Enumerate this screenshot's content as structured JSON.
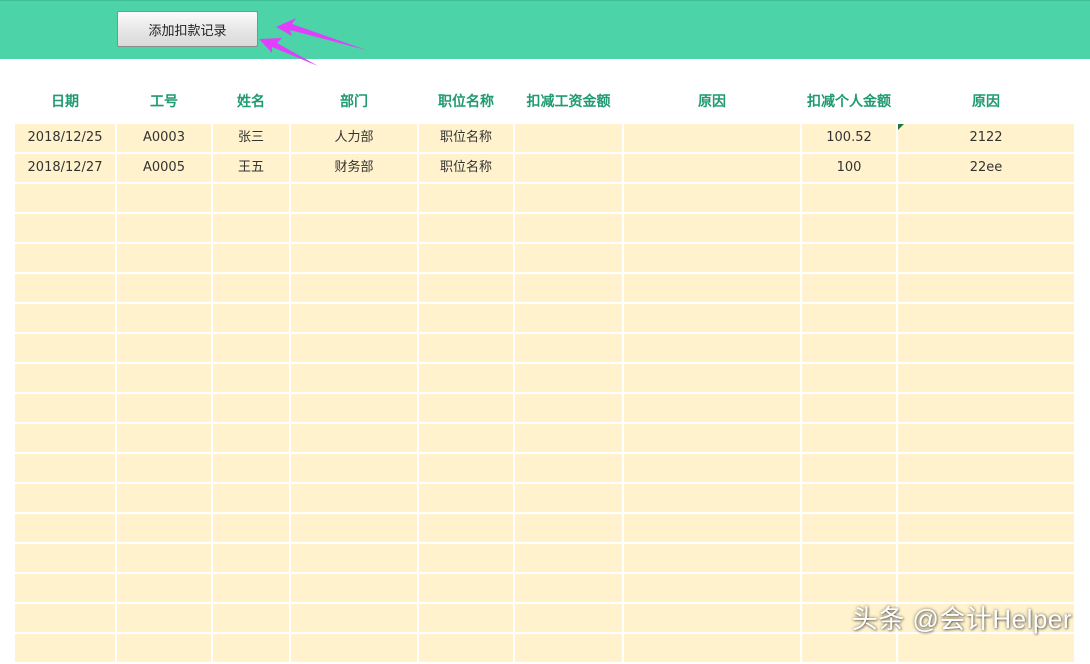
{
  "toolbar": {
    "add_button_label": "添加扣款记录",
    "accent_color": "#4cd3a8",
    "annotation_arrow_color": "#e040fb"
  },
  "table": {
    "headers": [
      "日期",
      "工号",
      "姓名",
      "部门",
      "职位名称",
      "扣减工资金额",
      "原因",
      "扣减个人金额",
      "原因"
    ],
    "rows": [
      [
        "2018/12/25",
        "A0003",
        "张三",
        "人力部",
        "职位名称",
        "",
        "",
        "100.52",
        "2122"
      ],
      [
        "2018/12/27",
        "A0005",
        "王五",
        "财务部",
        "职位名称",
        "",
        "",
        "100",
        "22ee"
      ]
    ],
    "row_fill_color": "#fff2cc",
    "header_text_color": "#1f9a72"
  },
  "watermark": {
    "text": "头条 @会计Helper"
  }
}
